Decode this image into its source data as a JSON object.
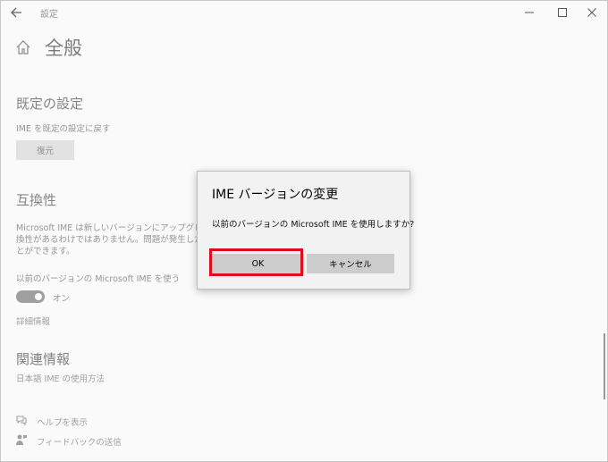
{
  "window": {
    "title": "設定",
    "highlight_color": "#e00c1e"
  },
  "page": {
    "title": "全般"
  },
  "default_settings": {
    "title": "既定の設定",
    "description": "IME を既定の設定に戻す",
    "restore_button": "復元"
  },
  "compatibility": {
    "title": "互換性",
    "description_line1": "Microsoft IME は新しいバージョンにアップグレードさ",
    "description_line2": "換性があるわけではありません。問題が発生した場合",
    "description_line3": "とができます。",
    "toggle_label": "以前のバージョンの Microsoft IME を使う",
    "toggle_state": "オン",
    "details_link": "詳細情報"
  },
  "related": {
    "title": "関連情報",
    "link": "日本語 IME の使用方法"
  },
  "footer": {
    "help": "ヘルプを表示",
    "feedback": "フィードバックの送信"
  },
  "dialog": {
    "title": "IME バージョンの変更",
    "message": "以前のバージョンの Microsoft IME を使用しますか?",
    "ok_button": "OK",
    "cancel_button": "キャンセル"
  }
}
